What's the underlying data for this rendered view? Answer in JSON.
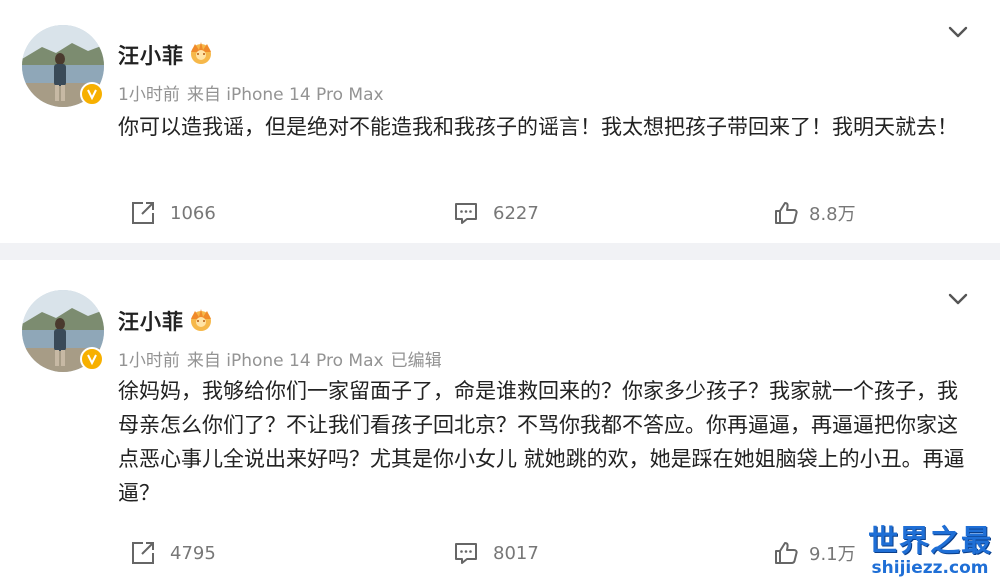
{
  "posts": [
    {
      "username": "汪小菲",
      "time": "1小时前",
      "source": "来自 iPhone 14 Pro Max",
      "edited": "",
      "content": "你可以造我谣，但是绝对不能造我和我孩子的谣言！我太想把孩子带回来了！我明天就去！",
      "reposts": "1066",
      "comments": "6227",
      "likes": "8.8万"
    },
    {
      "username": "汪小菲",
      "time": "1小时前",
      "source": "来自 iPhone 14 Pro Max",
      "edited": "已编辑",
      "content": "徐妈妈，我够给你们一家留面子了，命是谁救回来的？你家多少孩子？我家就一个孩子，我母亲怎么你们了？不让我们看孩子回北京？不骂你我都不答应。你再逼逼，再逼逼把你家这点恶心事儿全说出来好吗？尤其是你小女儿 就她跳的欢，她是踩在她姐脑袋上的小丑。再逼逼？",
      "reposts": "4795",
      "comments": "8017",
      "likes": "9.1万"
    }
  ],
  "icons": {
    "verify": "verified-v-badge-icon",
    "member": "crown-member-icon",
    "more": "chevron-down-icon",
    "repost": "repost-icon",
    "comment": "comment-icon",
    "like": "thumbs-up-icon"
  },
  "colors": {
    "verify_badge": "#f7b000",
    "meta_text": "#939393",
    "separator": "#f1f2f5",
    "watermark": "#1f6fd6"
  },
  "watermark": {
    "title": "世界之最",
    "url": "shijiezz.com"
  }
}
